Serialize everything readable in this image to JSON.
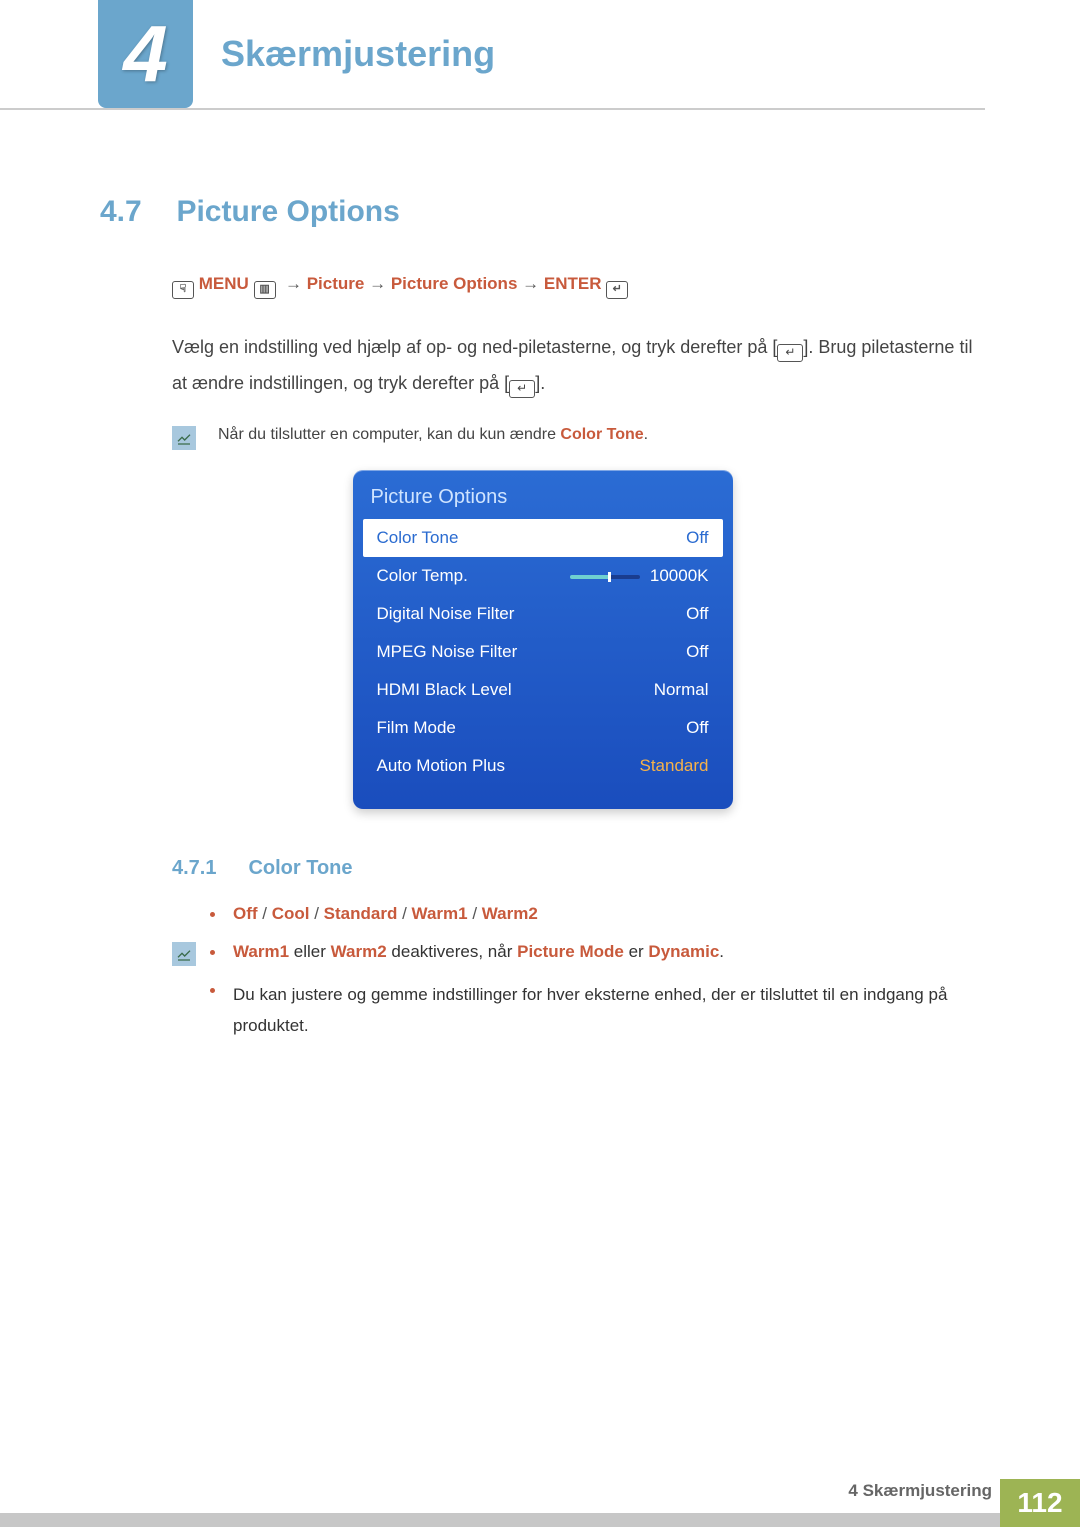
{
  "chapter": {
    "number": "4",
    "title": "Skærmjustering"
  },
  "section": {
    "number": "4.7",
    "title": "Picture Options"
  },
  "nav": {
    "menu": "MENU",
    "arrow": "→",
    "picture": "Picture",
    "picture_options": "Picture Options",
    "enter": "ENTER"
  },
  "body": {
    "p1a": "Vælg en indstilling ved hjælp af op- og ned-piletasterne, og tryk derefter på [",
    "p1b": "]. Brug piletasterne til at ændre indstillingen, og tryk derefter på [",
    "p1c": "]."
  },
  "note1": {
    "pre": "Når du tilslutter en computer, kan du kun ændre ",
    "em": "Color Tone",
    "post": "."
  },
  "osd": {
    "title": "Picture Options",
    "rows": [
      {
        "label": "Color Tone",
        "value": "Off",
        "selected": true
      },
      {
        "label": "Color Temp.",
        "value": "10000K",
        "slider": true
      },
      {
        "label": "Digital Noise Filter",
        "value": "Off"
      },
      {
        "label": "MPEG Noise Filter",
        "value": "Off"
      },
      {
        "label": "HDMI Black Level",
        "value": "Normal"
      },
      {
        "label": "Film Mode",
        "value": "Off"
      },
      {
        "label": "Auto Motion Plus",
        "value": "Standard",
        "orange": true
      }
    ]
  },
  "subsection": {
    "number": "4.7.1",
    "title": "Color Tone"
  },
  "bullets": {
    "options": {
      "off": "Off",
      "sep": " / ",
      "cool": "Cool",
      "standard": "Standard",
      "warm1": "Warm1",
      "warm2": "Warm2"
    },
    "b2": {
      "w1": "Warm1",
      "mid1": " eller ",
      "w2": "Warm2",
      "mid2": " deaktiveres, når ",
      "pm": "Picture Mode",
      "mid3": " er ",
      "dyn": "Dynamic",
      "post": "."
    },
    "b3": "Du kan justere og gemme indstillinger for hver eksterne enhed, der er tilsluttet til en indgang på produktet."
  },
  "footer": {
    "chapter_label": "4  Skærmjustering",
    "page": "112"
  }
}
